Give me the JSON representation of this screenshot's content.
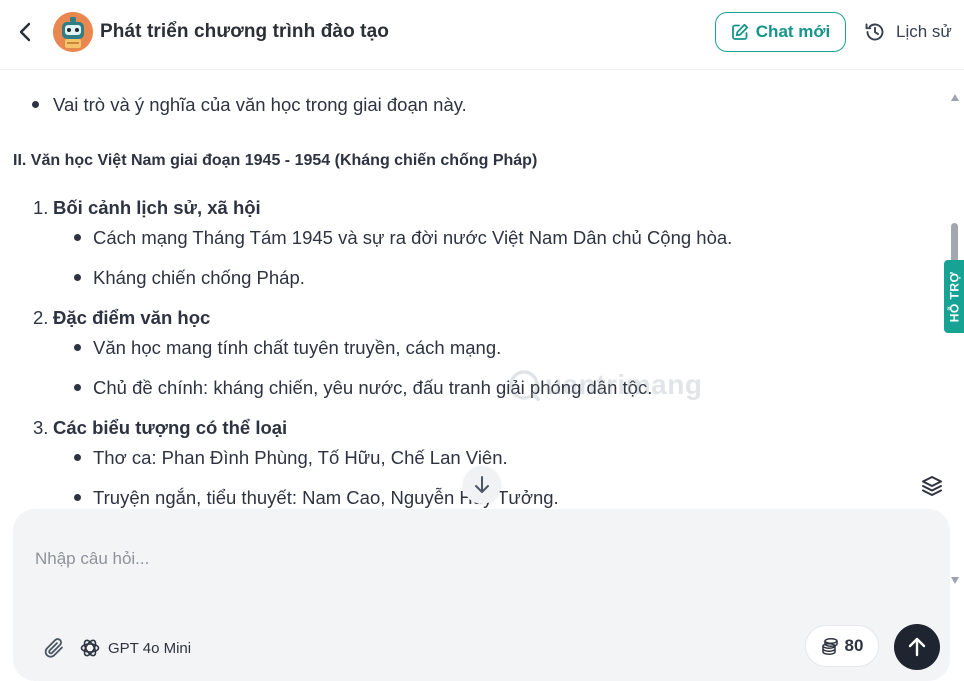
{
  "header": {
    "title": "Phát triển chương trình đào tạo",
    "chat_new_label": "Chat mới",
    "history_label": "Lịch sử",
    "accent_color": "#16a394"
  },
  "content": {
    "top_bullet": "Vai trò và ý nghĩa của văn học trong giai đoạn này.",
    "section_heading": "II. Văn học Việt Nam giai đoạn 1945 - 1954 (Kháng chiến chống Pháp)",
    "items": [
      {
        "number": "1.",
        "title": "Bối cảnh lịch sử, xã hội",
        "bullets": [
          "Cách mạng Tháng Tám 1945 và sự ra đời nước Việt Nam Dân chủ Cộng hòa.",
          "Kháng chiến chống Pháp."
        ]
      },
      {
        "number": "2.",
        "title": "Đặc điểm văn học",
        "bullets": [
          "Văn học mang tính chất tuyên truyền, cách mạng.",
          "Chủ đề chính: kháng chiến, yêu nước, đấu tranh giải phóng dân tộc."
        ]
      },
      {
        "number": "3.",
        "title": "Các biểu tượng có thể loại",
        "bullets": [
          "Thơ ca: Phan Đình Phùng, Tố Hữu, Chế Lan Viên.",
          "Truyện ngắn, tiểu thuyết: Nam Cao, Nguyễn Huy Tưởng."
        ]
      }
    ]
  },
  "watermark_text": "uantrimang",
  "support_tab_label": "HỖ TRỢ",
  "composer": {
    "placeholder": "Nhập câu hỏi...",
    "model_label": "GPT 4o Mini",
    "credits": "80"
  },
  "icons": {
    "back": "chevron-left-icon",
    "avatar": "robot-avatar-icon",
    "chat_new": "edit-icon",
    "history": "history-icon",
    "scroll_down": "arrow-down-icon",
    "layers": "layers-icon",
    "attach": "paperclip-icon",
    "model": "openai-icon",
    "credits": "coins-icon",
    "send": "arrow-up-icon"
  }
}
